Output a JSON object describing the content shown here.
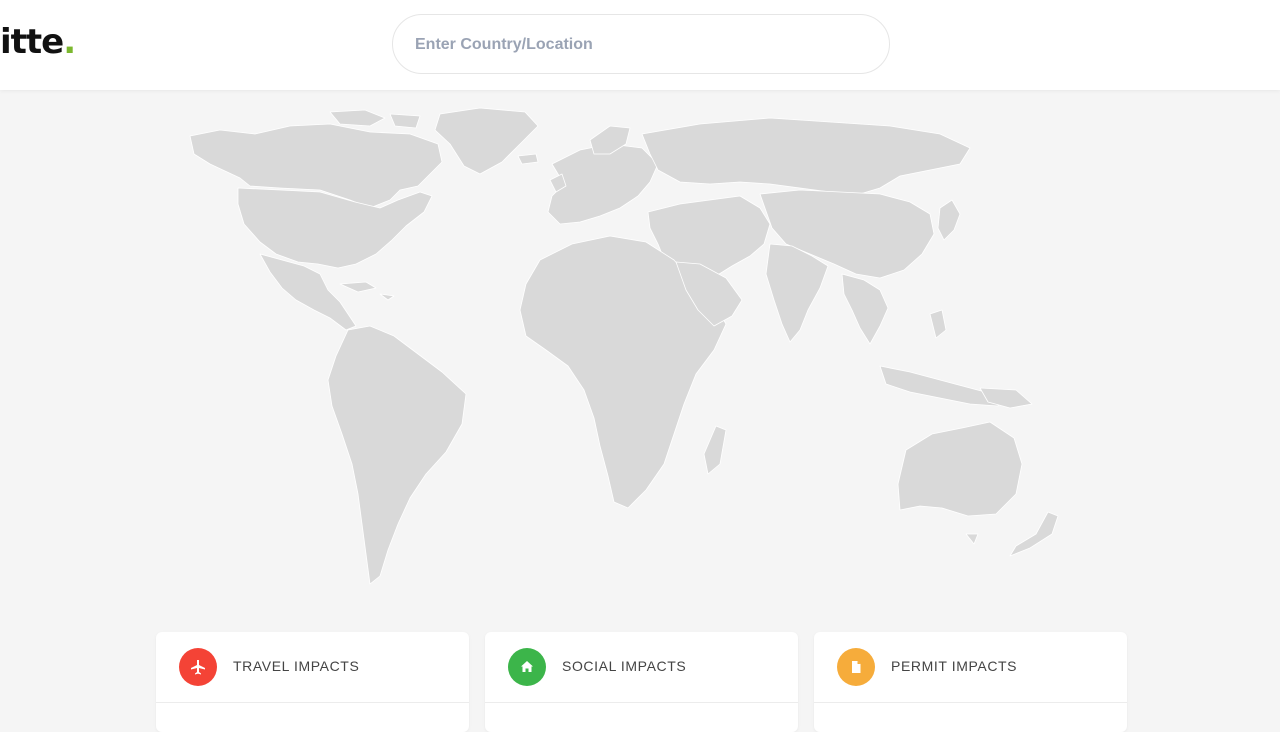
{
  "header": {
    "logo_text": "itte",
    "logo_dot": ".",
    "search": {
      "placeholder": "Enter Country/Location",
      "value": ""
    }
  },
  "colors": {
    "logo_accent": "#7cb82f",
    "map_land": "#d9d9d9",
    "page_bg": "#f5f5f5",
    "travel": "#f44336",
    "social": "#3cb54a",
    "permit": "#f6ac3b"
  },
  "cards": [
    {
      "title": "TRAVEL IMPACTS",
      "icon": "airplane-icon"
    },
    {
      "title": "SOCIAL IMPACTS",
      "icon": "home-icon"
    },
    {
      "title": "PERMIT IMPACTS",
      "icon": "document-icon"
    }
  ]
}
